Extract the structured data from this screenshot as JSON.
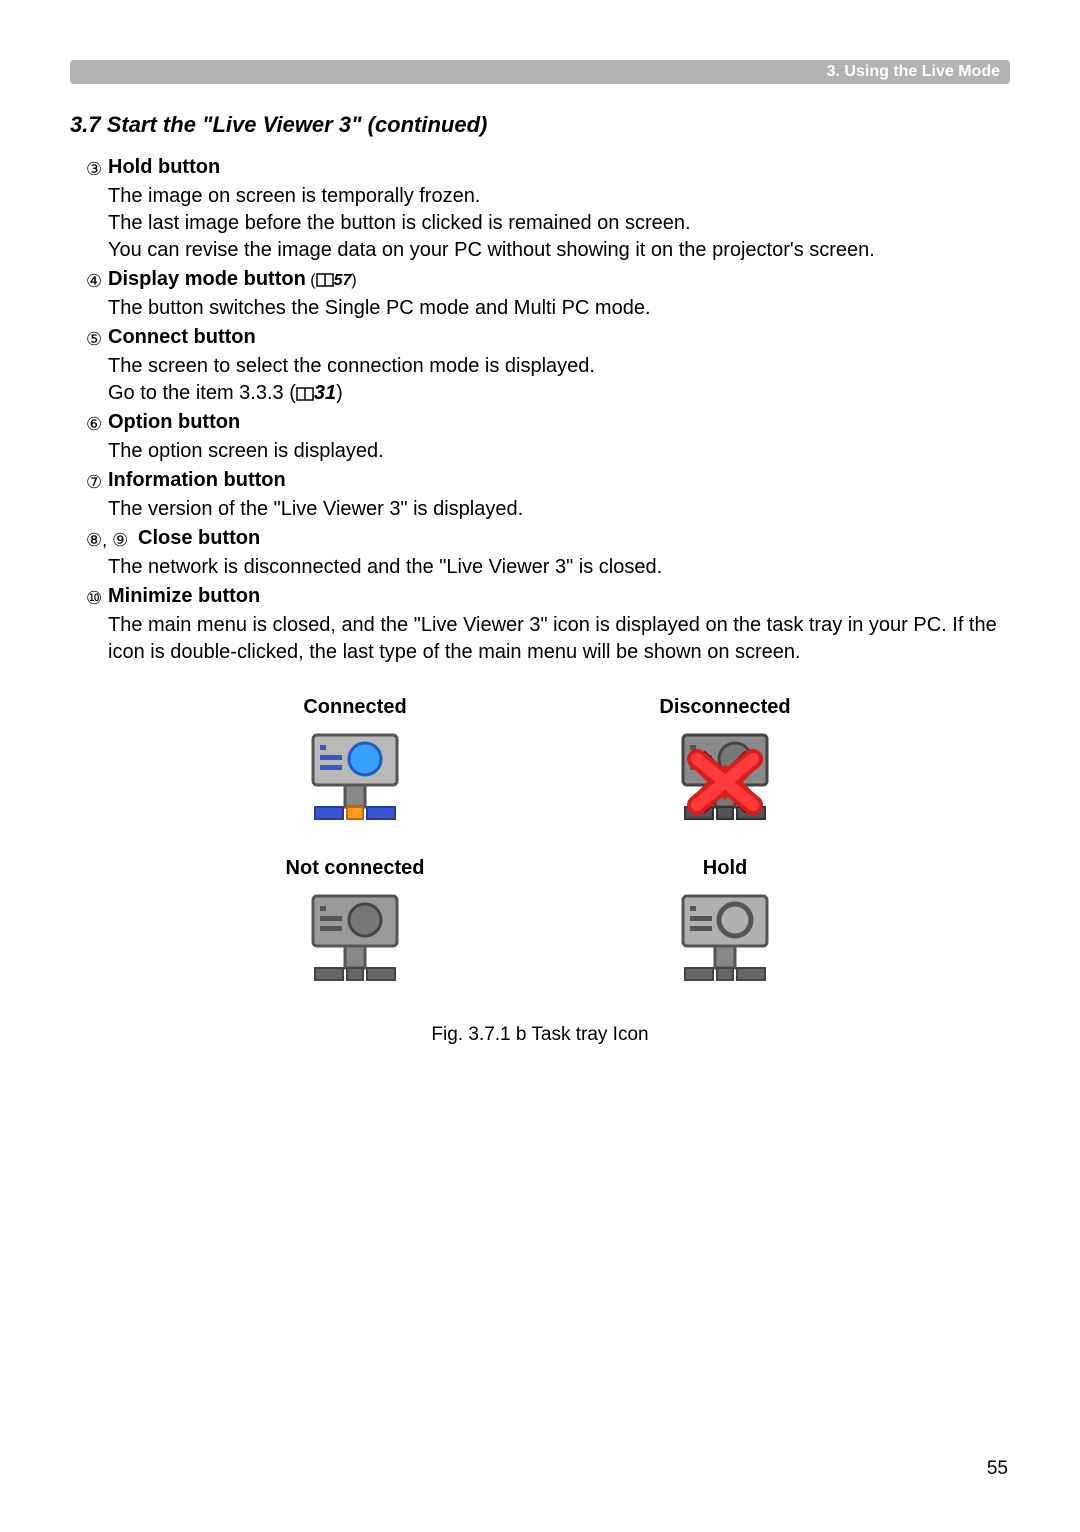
{
  "header": {
    "chapter": "3. Using the Live Mode"
  },
  "section_title": "3.7 Start the \"Live Viewer 3\" (continued)",
  "items": [
    {
      "num": "③",
      "title": "Hold button",
      "body": "The image on screen is temporally frozen.\nThe last image before the button is clicked is remained on screen.\nYou can revise the image data on your PC without showing it on the projector's screen."
    },
    {
      "num": "④",
      "title": "Display mode button",
      "ref_after_title": "57",
      "body": "The button switches the Single PC mode and Multi PC mode."
    },
    {
      "num": "⑤",
      "title": "Connect button",
      "body": "The screen to select the connection mode is displayed.",
      "body2_prefix": "Go to the item 3.3.3 (",
      "body2_ref": "31",
      "body2_suffix": ")"
    },
    {
      "num": "⑥",
      "title": "Option button",
      "body": "The option screen is displayed."
    },
    {
      "num": "⑦",
      "title": "Information button",
      "body": "The version of the \"Live Viewer 3\" is displayed."
    },
    {
      "num": "⑧, ⑨",
      "title": "Close button",
      "body": "The network is disconnected and the \"Live Viewer 3\" is closed."
    },
    {
      "num": "⑩",
      "title": "Minimize button",
      "body": "The main menu is closed, and the \"Live Viewer 3\" icon is displayed on the task tray in your PC. If the icon is double-clicked, the last type of the main menu will be shown on screen."
    }
  ],
  "icons": {
    "connected": "Connected",
    "disconnected": "Disconnected",
    "not_connected": "Not connected",
    "hold": "Hold"
  },
  "fig_caption": "Fig. 3.7.1 b  Task tray Icon",
  "page_number": "55"
}
